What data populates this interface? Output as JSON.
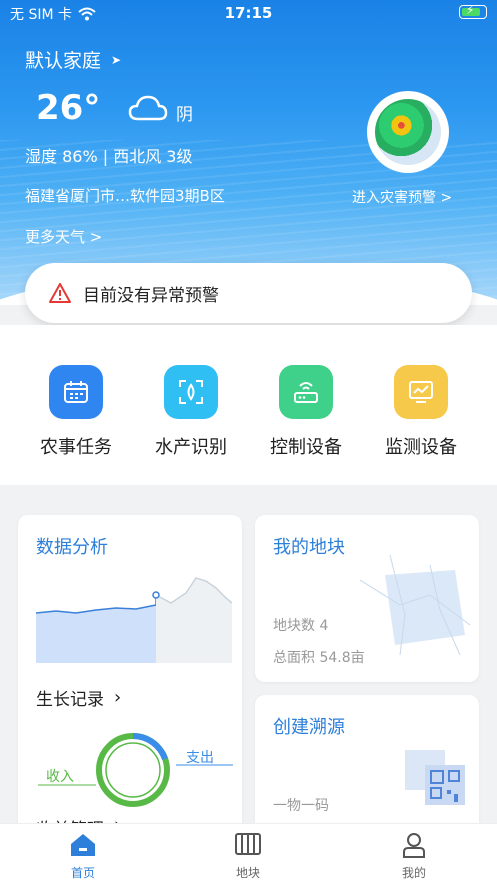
{
  "status_bar": {
    "carrier": "无 SIM 卡",
    "time": "17:15"
  },
  "header": {
    "family_name": "默认家庭",
    "temperature": "26°",
    "weather": "阴",
    "humidity_wind": "湿度 86% | 西北风 3级",
    "location": "福建省厦门市…软件园3期B区",
    "more_weather": "更多天气 >",
    "disaster_link": "进入灾害预警 >"
  },
  "alert": {
    "text": "目前没有异常预警"
  },
  "quick_actions": [
    {
      "label": "农事任务",
      "icon": "calendar-icon",
      "color": "#2f86f0"
    },
    {
      "label": "水产识别",
      "icon": "fish-scan-icon",
      "color": "#2fbff3"
    },
    {
      "label": "控制设备",
      "icon": "router-icon",
      "color": "#3fd18a"
    },
    {
      "label": "监测设备",
      "icon": "monitor-icon",
      "color": "#f7c94a"
    }
  ],
  "data_card": {
    "title": "数据分析",
    "growth_label": "生长记录",
    "income_label": "收入",
    "expense_label": "支出",
    "income_mgmt_label": "收益管理"
  },
  "plot_card": {
    "title": "我的地块",
    "count_label": "地块数 4",
    "area_label": "总面积 54.8亩"
  },
  "trace_card": {
    "title": "创建溯源",
    "subtitle": "一物一码"
  },
  "tabs": [
    {
      "label": "首页",
      "icon": "home-icon",
      "active": true
    },
    {
      "label": "地块",
      "icon": "plot-icon",
      "active": false
    },
    {
      "label": "我的",
      "icon": "user-icon",
      "active": false
    }
  ],
  "colors": {
    "accent": "#2d7fd9",
    "income": "#58b947",
    "expense": "#3a8de8"
  }
}
